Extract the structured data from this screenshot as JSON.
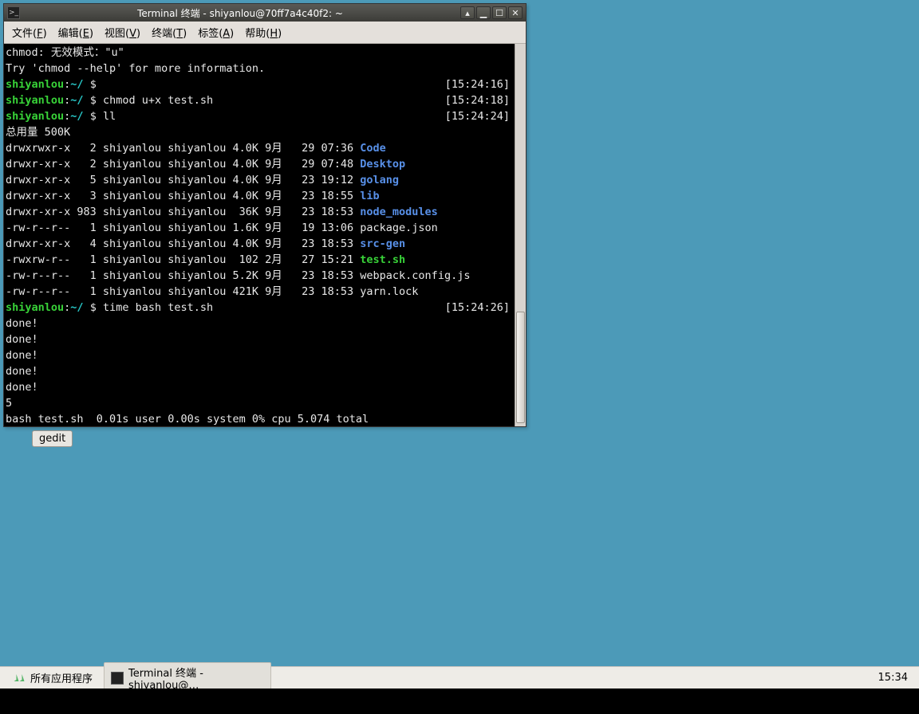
{
  "window": {
    "title": "Terminal 终端 - shiyanlou@70ff7a4c40f2: ~",
    "buttons": {
      "rollup": "▴",
      "min": "▁",
      "max": "☐",
      "close": "✕"
    }
  },
  "menu": {
    "file": {
      "pre": "文件(",
      "u": "F",
      "post": ")"
    },
    "edit": {
      "pre": "编辑(",
      "u": "E",
      "post": ")"
    },
    "view": {
      "pre": "视图(",
      "u": "V",
      "post": ")"
    },
    "term": {
      "pre": "终端(",
      "u": "T",
      "post": ")"
    },
    "tabs": {
      "pre": "标签(",
      "u": "A",
      "post": ")"
    },
    "help": {
      "pre": "帮助(",
      "u": "H",
      "post": ")"
    }
  },
  "shell": {
    "user": "shiyanlou",
    "sep": ":",
    "path": "~/",
    "prompt": " $ ",
    "err1": "chmod: 无效模式：\"u\"",
    "err2": "Try 'chmod --help' for more information.",
    "ts1": "[15:24:16]",
    "cmd_chmod": "chmod u+x test.sh",
    "ts2": "[15:24:18]",
    "cmd_ll": "ll",
    "ts3": "[15:24:24]",
    "total": "总用量 500K",
    "cmd_time": "time bash test.sh",
    "ts4": "[15:24:26]",
    "done": "done!",
    "five": "5",
    "timing": "bash test.sh  0.01s user 0.00s system 0% cpu 5.074 total"
  },
  "ls": [
    {
      "perm": "drwxrwxr-x",
      "n": "  2",
      "o": "shiyanlou",
      "g": "shiyanlou",
      "sz": "4.0K",
      "mo": "9月 ",
      "d": " 29",
      "t": "07:36",
      "name": "Code",
      "cls": "dir"
    },
    {
      "perm": "drwxr-xr-x",
      "n": "  2",
      "o": "shiyanlou",
      "g": "shiyanlou",
      "sz": "4.0K",
      "mo": "9月 ",
      "d": " 29",
      "t": "07:48",
      "name": "Desktop",
      "cls": "dir"
    },
    {
      "perm": "drwxr-xr-x",
      "n": "  5",
      "o": "shiyanlou",
      "g": "shiyanlou",
      "sz": "4.0K",
      "mo": "9月 ",
      "d": " 23",
      "t": "19:12",
      "name": "golang",
      "cls": "dir"
    },
    {
      "perm": "drwxr-xr-x",
      "n": "  3",
      "o": "shiyanlou",
      "g": "shiyanlou",
      "sz": "4.0K",
      "mo": "9月 ",
      "d": " 23",
      "t": "18:55",
      "name": "lib",
      "cls": "dir"
    },
    {
      "perm": "drwxr-xr-x",
      "n": "983",
      "o": "shiyanlou",
      "g": "shiyanlou",
      "sz": " 36K",
      "mo": "9月 ",
      "d": " 23",
      "t": "18:53",
      "name": "node_modules",
      "cls": "dir"
    },
    {
      "perm": "-rw-r--r--",
      "n": "  1",
      "o": "shiyanlou",
      "g": "shiyanlou",
      "sz": "1.6K",
      "mo": "9月 ",
      "d": " 19",
      "t": "13:06",
      "name": "package.json",
      "cls": ""
    },
    {
      "perm": "drwxr-xr-x",
      "n": "  4",
      "o": "shiyanlou",
      "g": "shiyanlou",
      "sz": "4.0K",
      "mo": "9月 ",
      "d": " 23",
      "t": "18:53",
      "name": "src-gen",
      "cls": "dir"
    },
    {
      "perm": "-rwxrw-r--",
      "n": "  1",
      "o": "shiyanlou",
      "g": "shiyanlou",
      "sz": " 102",
      "mo": "2月 ",
      "d": " 27",
      "t": "15:21",
      "name": "test.sh",
      "cls": "exec"
    },
    {
      "perm": "-rw-r--r--",
      "n": "  1",
      "o": "shiyanlou",
      "g": "shiyanlou",
      "sz": "5.2K",
      "mo": "9月 ",
      "d": " 23",
      "t": "18:53",
      "name": "webpack.config.js",
      "cls": ""
    },
    {
      "perm": "-rw-r--r--",
      "n": "  1",
      "o": "shiyanlou",
      "g": "shiyanlou",
      "sz": "421K",
      "mo": "9月 ",
      "d": " 23",
      "t": "18:53",
      "name": "yarn.lock",
      "cls": ""
    }
  ],
  "desktop": {
    "gedit": "gedit"
  },
  "taskbar": {
    "apps": "所有应用程序",
    "term": "Terminal 终端 - shiyanlou@…",
    "clock": "15:34"
  }
}
